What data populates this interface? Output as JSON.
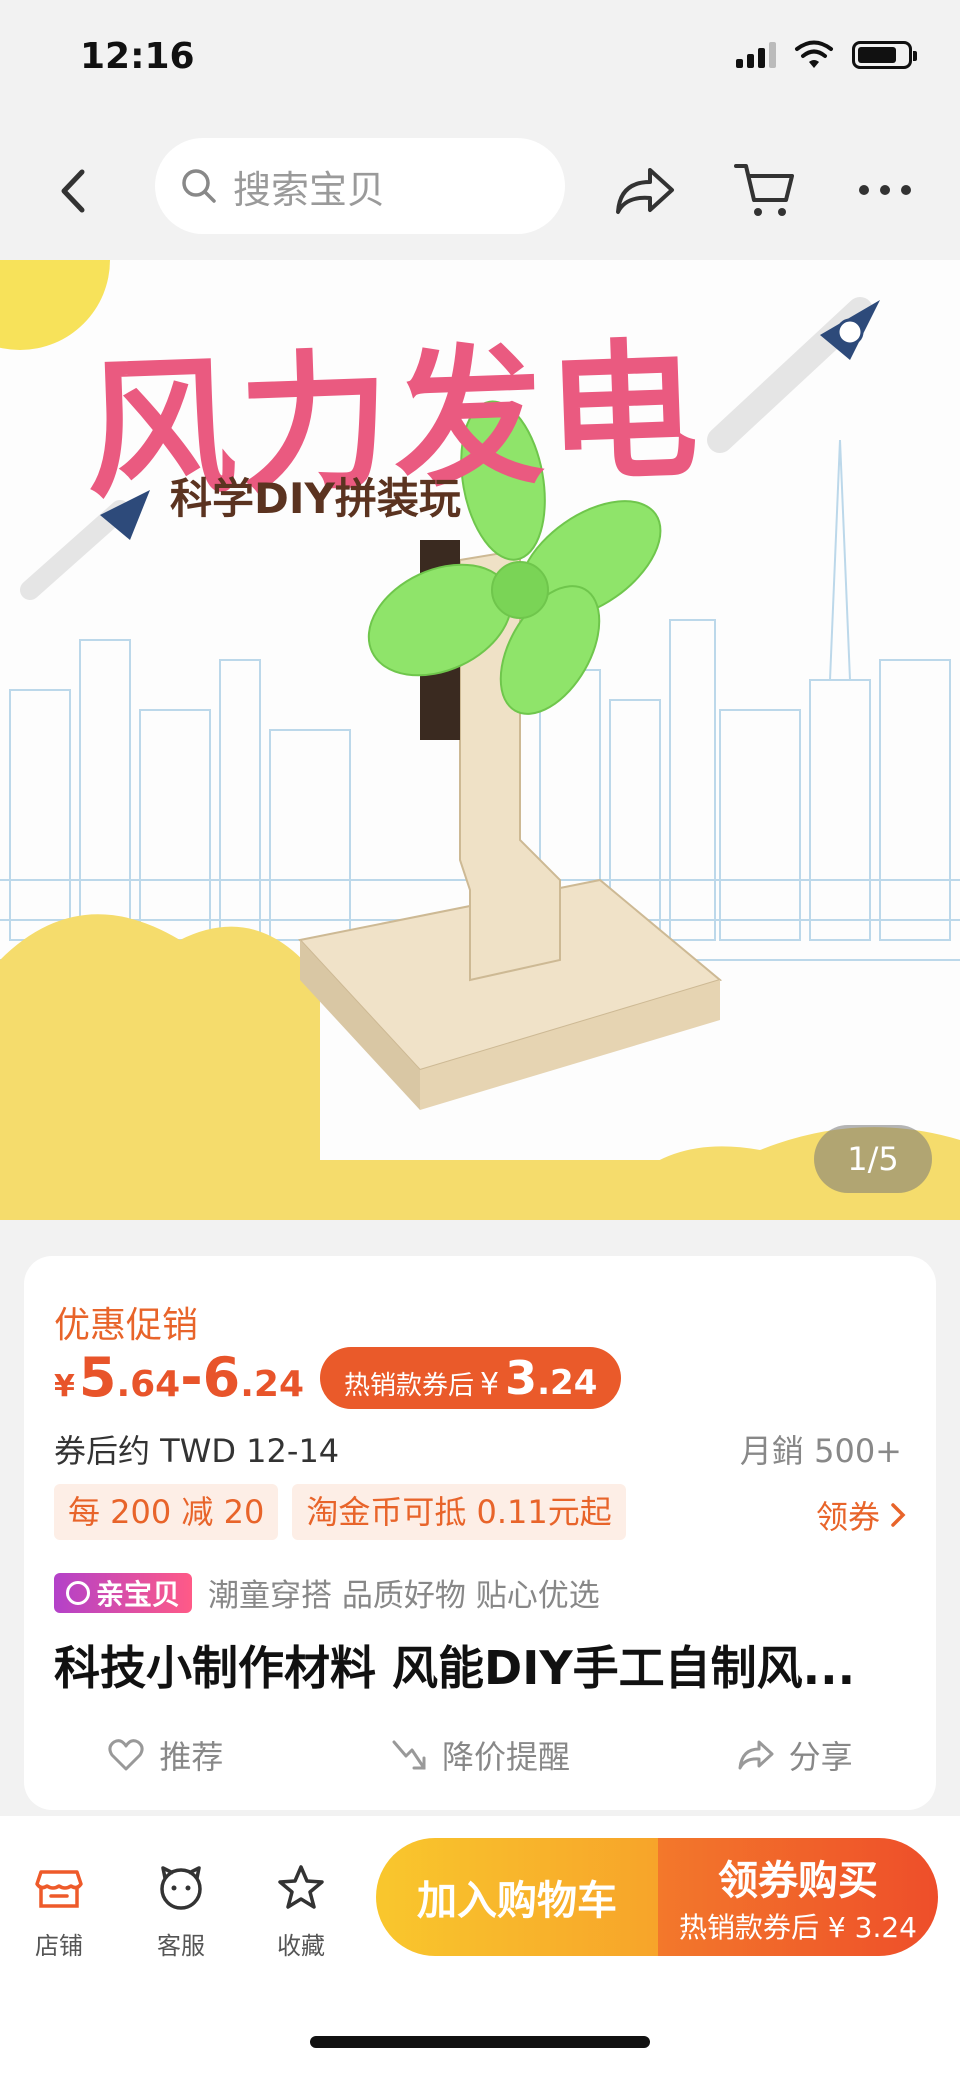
{
  "status_bar": {
    "time": "12:16"
  },
  "header": {
    "search_placeholder": "搜索宝贝",
    "icons": [
      "back-icon",
      "search-icon",
      "share-icon",
      "cart-icon",
      "more-icon"
    ]
  },
  "hero": {
    "title": "风力发电",
    "subtitle": "科学DIY拼装玩",
    "page_indicator": "1/5"
  },
  "product": {
    "promo_label": "优惠促销",
    "price": {
      "yen": "¥",
      "low_int": "5",
      "low_dec": ".64",
      "dash": "-",
      "high_int": "6",
      "high_dec": ".24"
    },
    "coupon_badge": {
      "text": "热销款券后",
      "yen": "¥",
      "int": "3",
      "dec": ".24"
    },
    "twd_text": "券后约 TWD 12-14",
    "sales_text": "月銷 500+",
    "tags": [
      "每 200 减 20",
      "淘金币可抵 0.11元起"
    ],
    "get_coupon": "领券",
    "brand_badge": "亲宝贝",
    "slogan": "潮童穿搭 品质好物 贴心优选",
    "title": "科技小制作材料 风能DIY手工自制风...",
    "actions": {
      "recommend": "推荐",
      "price_alert": "降价提醒",
      "share": "分享"
    }
  },
  "bottom_bar": {
    "store": "店铺",
    "service": "客服",
    "favorite": "收藏",
    "add_to_cart": "加入购物车",
    "buy_line1": "领券购买",
    "buy_line2": "热销款券后 ¥ 3.24"
  },
  "colors": {
    "accent": "#e8642a",
    "price": "#e8542a",
    "cart_yellow": "#f9c72d",
    "buy_orange": "#ee4e2a"
  }
}
